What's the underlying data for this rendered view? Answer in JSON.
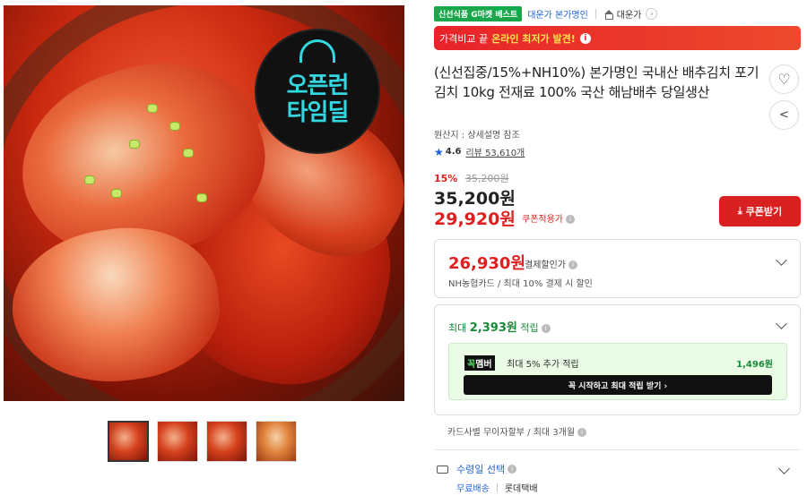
{
  "gallery": {
    "badge_line1": "오픈런",
    "badge_line2": "타임딜",
    "thumbnail_count": 4
  },
  "breadcrumb": {
    "best_badge": "신선식품 G마켓 베스트",
    "seller": "대운가 본가명인",
    "shop_name": "대운가"
  },
  "banner": {
    "prefix": "가격비교 끝",
    "highlight": "온라인 최저가 발견!",
    "info_icon": "i"
  },
  "product": {
    "title": "(신선집중/15%+NH10%) 본가명인 국내산 배추김치 포기김치 10kg 전재료 100% 국산 해남배추 당일생산",
    "origin": "원산지 : 상세설명 참조",
    "rating": "4.6",
    "reviews": "리뷰 53,610개"
  },
  "pricing": {
    "discount_pct": "15%",
    "original_price": "35,200원",
    "price": "35,200원",
    "coupon_price": "29,920원",
    "coupon_label": "쿠폰적용가",
    "coupon_button": "쿠폰받기"
  },
  "payment_discount": {
    "amount": "26,930원",
    "label": "결제할인가",
    "detail": "NH농협카드 / 최대 10% 결제 시 할인"
  },
  "points": {
    "label_prefix": "최대",
    "amount": "2,393원",
    "label_suffix": "적립",
    "member_tag_g": "꼭",
    "member_tag": "멤버",
    "member_text": "최대 5% 추가 적립",
    "member_points": "1,496원",
    "cta": "꼭 시작하고 최대 적립 받기 ›"
  },
  "installment": "카드사별 무이자할부 / 최대 3개월",
  "delivery": {
    "label": "수령일 선택",
    "option_free": "무료배송",
    "carrier": "롯데택배"
  },
  "colors": {
    "accent_red": "#e02020",
    "banner_red": "#e8232a",
    "brand_blue": "#1e63d6",
    "points_green": "#1a8a3a",
    "best_green": "#1aa64a"
  }
}
